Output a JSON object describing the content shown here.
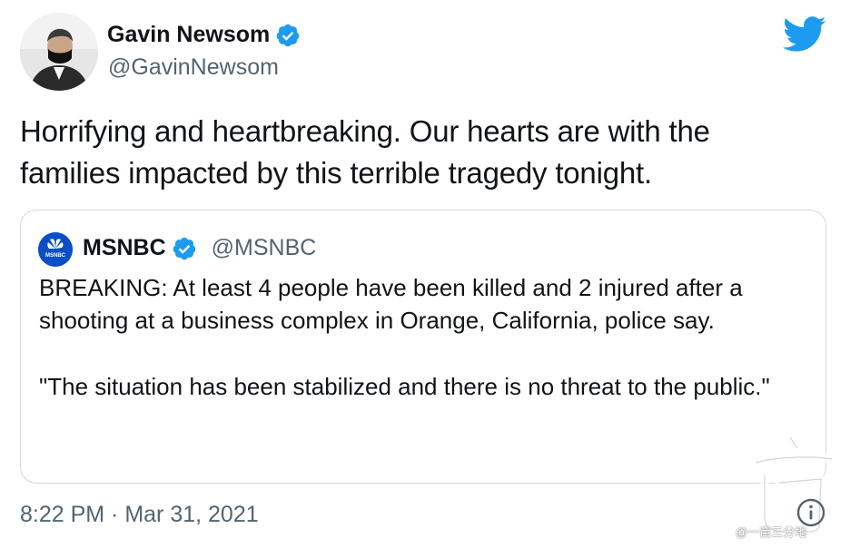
{
  "author": {
    "name": "Gavin Newsom",
    "handle": "@GavinNewsom",
    "verified": true
  },
  "icons": {
    "verified_badge": "verified-badge-icon",
    "brand": "twitter-bird-icon",
    "info": "info-icon"
  },
  "tweet": {
    "text_line1": "Horrifying and heartbreaking. Our hearts are with the",
    "text_line2": "families impacted by this terrible tragedy tonight."
  },
  "quoted_tweet": {
    "name": "MSNBC",
    "handle": "@MSNBC",
    "verified": true,
    "paragraph1": "BREAKING: At least 4 people have been killed and 2 injured after a shooting at a business complex in Orange, California, police say.",
    "paragraph2": "\"The situation has been stabilized and there is no threat to the public.\""
  },
  "timestamp": "8:22 PM · Mar 31, 2021",
  "watermark": "@一亩三分地",
  "colors": {
    "twitter_blue": "#1d9bf0",
    "text_primary": "#0f1419",
    "text_secondary": "#536471",
    "border": "#cfd9de"
  }
}
